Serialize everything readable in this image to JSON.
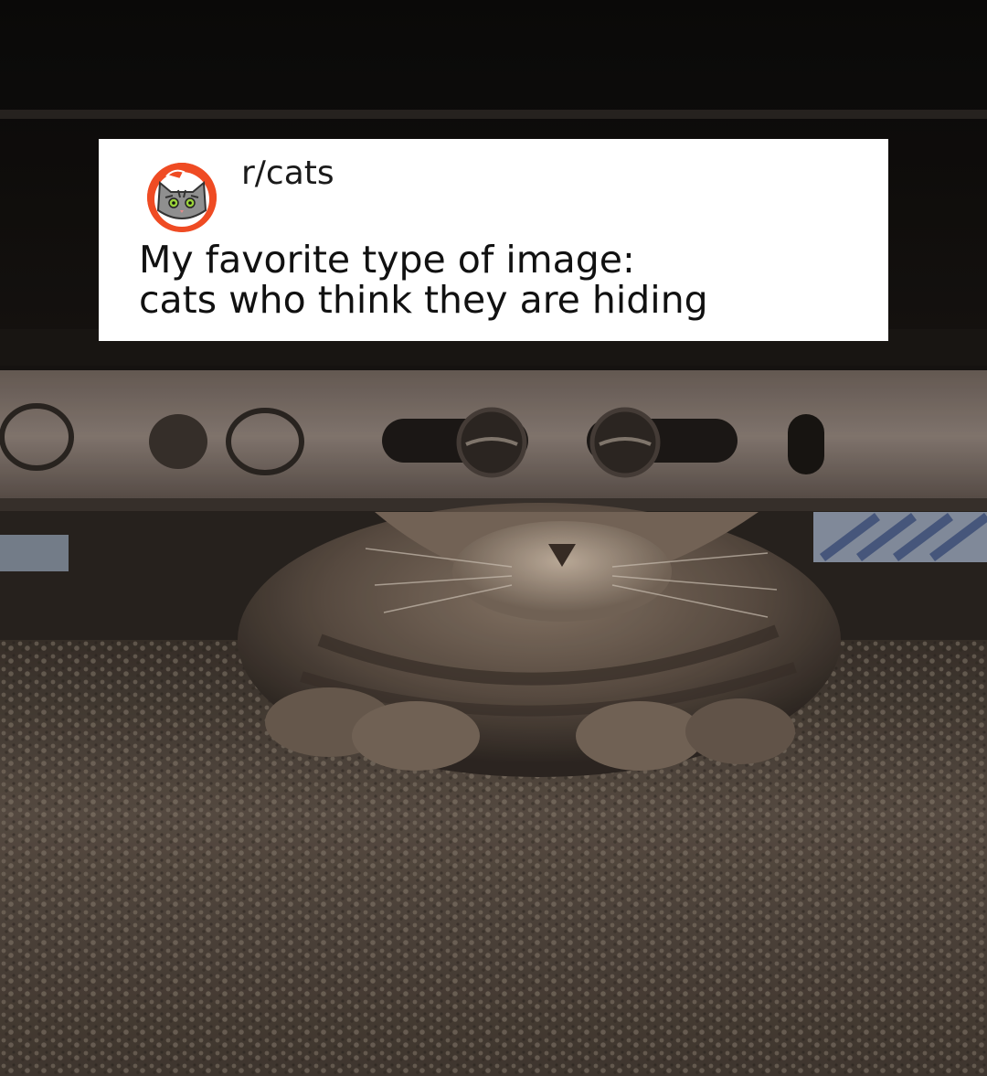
{
  "post": {
    "subreddit": "r/cats",
    "title_line1": "My favorite type of image:",
    "title_line2": "cats who think they are hiding"
  },
  "colors": {
    "card_background": "#ffffff",
    "avatar_background": "#ef4b23",
    "text": "#111111"
  },
  "icons": {
    "avatar": "cat-face-icon"
  }
}
